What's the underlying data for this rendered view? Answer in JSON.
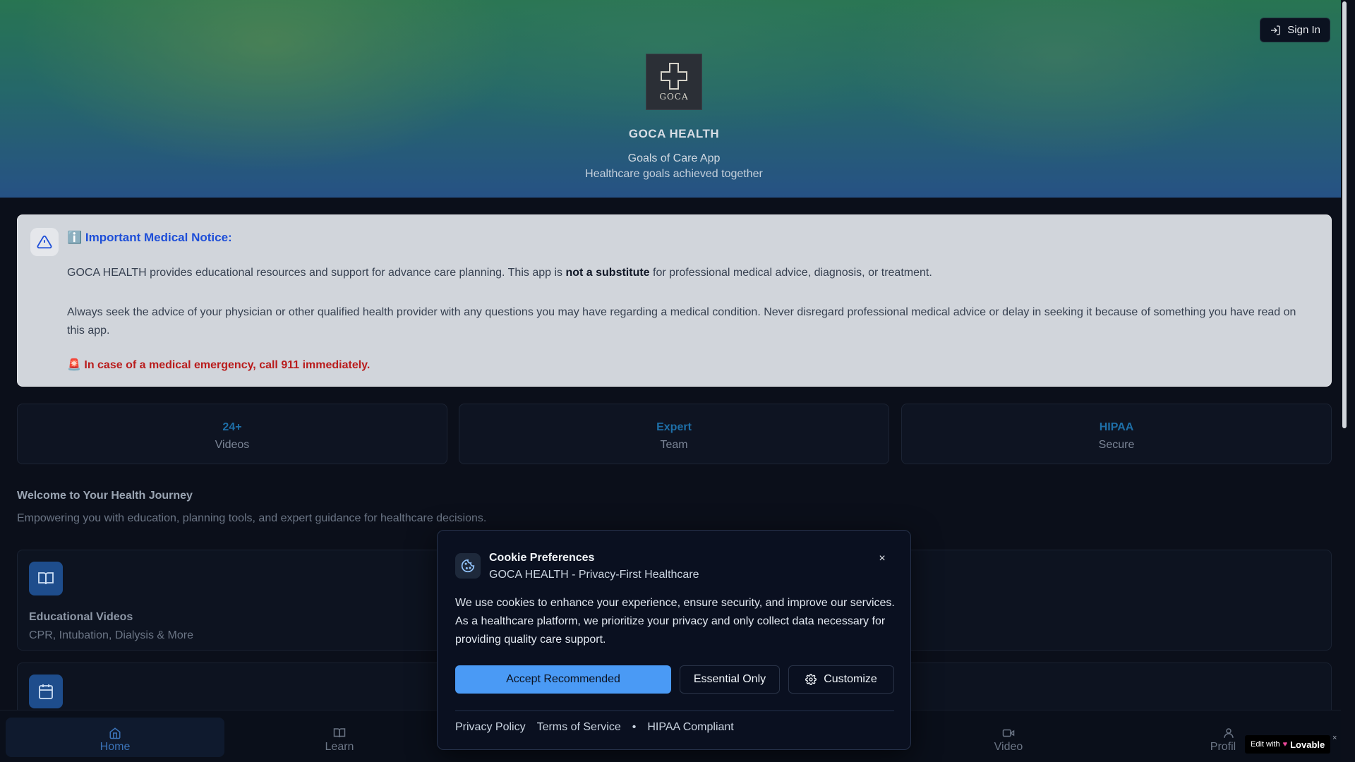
{
  "header": {
    "sign_in_label": "Sign In",
    "logo_text": "GOCA",
    "brand": "GOCA HEALTH",
    "tagline": "Goals of Care App",
    "subtagline": "Healthcare goals achieved together"
  },
  "notice": {
    "title": "ℹ️ Important Medical Notice:",
    "p1_before": "GOCA HEALTH provides educational resources and support for advance care planning. This app is ",
    "p1_bold": "not a substitute",
    "p1_after": " for professional medical advice, diagnosis, or treatment.",
    "p2": "Always seek the advice of your physician or other qualified health provider with any questions you may have regarding a medical condition. Never disregard professional medical advice or delay in seeking it because of something you have read on this app.",
    "emergency": "🚨 In case of a medical emergency, call 911 immediately."
  },
  "stats": [
    {
      "value": "24+",
      "label": "Videos"
    },
    {
      "value": "Expert",
      "label": "Team"
    },
    {
      "value": "HIPAA",
      "label": "Secure"
    }
  ],
  "welcome": {
    "title": "Welcome to Your Health Journey",
    "subtitle": "Empowering you with education, planning tools, and expert guidance for healthcare decisions."
  },
  "cards": [
    {
      "title": "Educational Videos",
      "subtitle": "CPR, Intubation, Dialysis & More",
      "icon": "book-icon"
    },
    {
      "icon": "calendar-icon"
    }
  ],
  "nav": [
    {
      "label": "Home",
      "icon": "home-icon",
      "active": true
    },
    {
      "label": "Learn",
      "icon": "book-icon"
    },
    {
      "label": "Video",
      "icon": "video-icon"
    },
    {
      "label": "Profil",
      "icon": "user-icon"
    }
  ],
  "cookie_modal": {
    "title": "Cookie Preferences",
    "subtitle": "GOCA HEALTH - Privacy-First Healthcare",
    "body": "We use cookies to enhance your experience, ensure security, and improve our services. As a healthcare platform, we prioritize your privacy and only collect data necessary for providing quality care support.",
    "accept_label": "Accept Recommended",
    "essential_label": "Essential Only",
    "customize_label": "Customize",
    "links": {
      "privacy": "Privacy Policy",
      "terms": "Terms of Service",
      "separator": "•",
      "hipaa": "HIPAA Compliant"
    },
    "close_glyph": "×"
  },
  "badge": {
    "prefix": "Edit with",
    "brand": "Lovable",
    "close_glyph": "×"
  },
  "colors": {
    "accent": "#4a9af5",
    "brand_blue": "#1d4ed8",
    "emergency_red": "#b91c1c",
    "stat_blue": "#1e6fa8"
  }
}
